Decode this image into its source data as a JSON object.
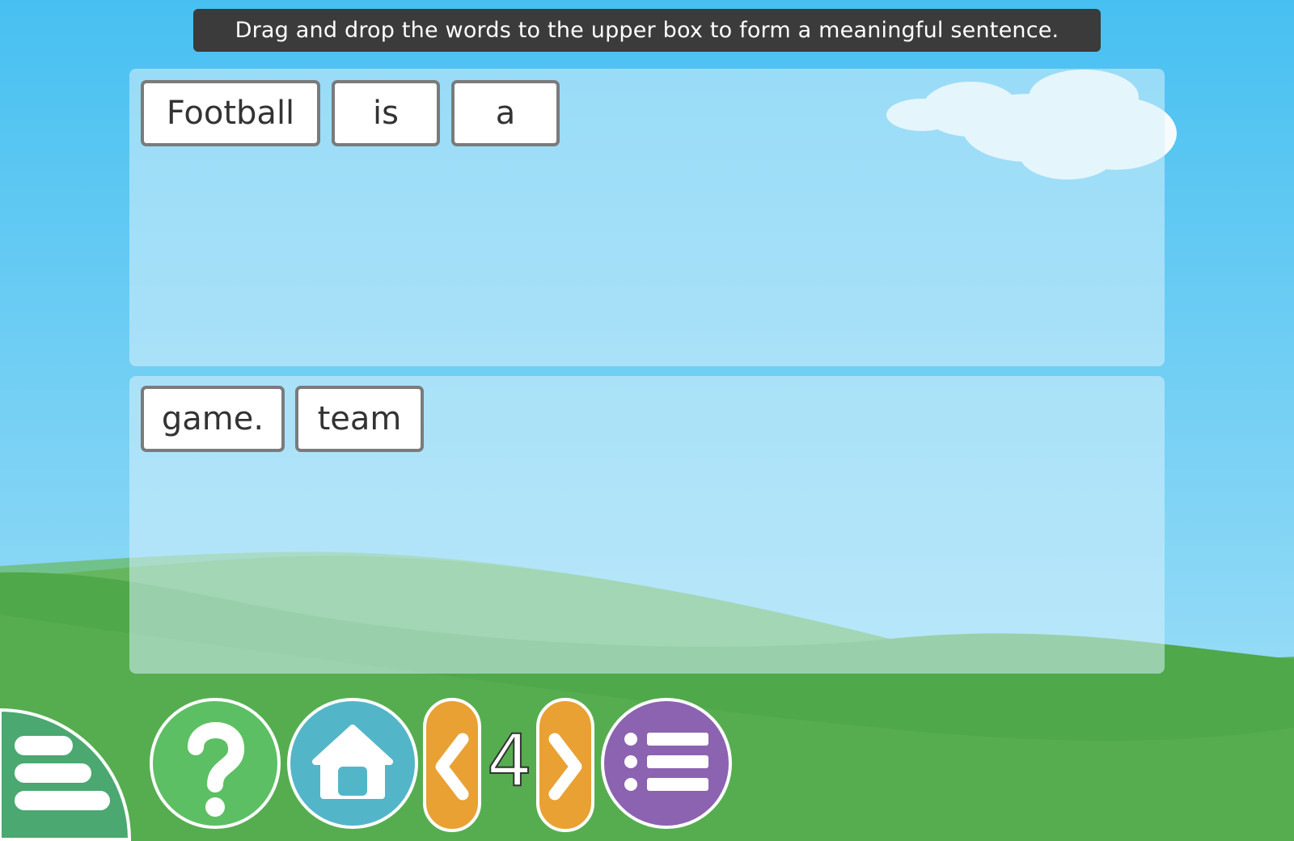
{
  "instruction": "Drag and drop the words to the upper box to form a meaningful sentence.",
  "upper_box": {
    "words": [
      "Football",
      "is",
      "a"
    ]
  },
  "lower_box": {
    "words": [
      "game.",
      "team"
    ]
  },
  "navigation": {
    "page_number": "4"
  },
  "icons": {
    "side_menu": "hamburger-icon",
    "help": "question-mark-icon",
    "home": "home-icon",
    "previous": "chevron-left-icon",
    "next": "chevron-right-icon",
    "list": "list-icon"
  },
  "colors": {
    "sky_top": "#4ec3f2",
    "sky_bottom": "#a8e2f8",
    "grass": "#4fa84a",
    "instruction_bg": "#3b3b3b",
    "help_button": "#5dbf63",
    "home_button": "#53b6c8",
    "arrow_buttons": "#e9a133",
    "list_button": "#8b63b0",
    "word_border": "#7b7b7b"
  }
}
